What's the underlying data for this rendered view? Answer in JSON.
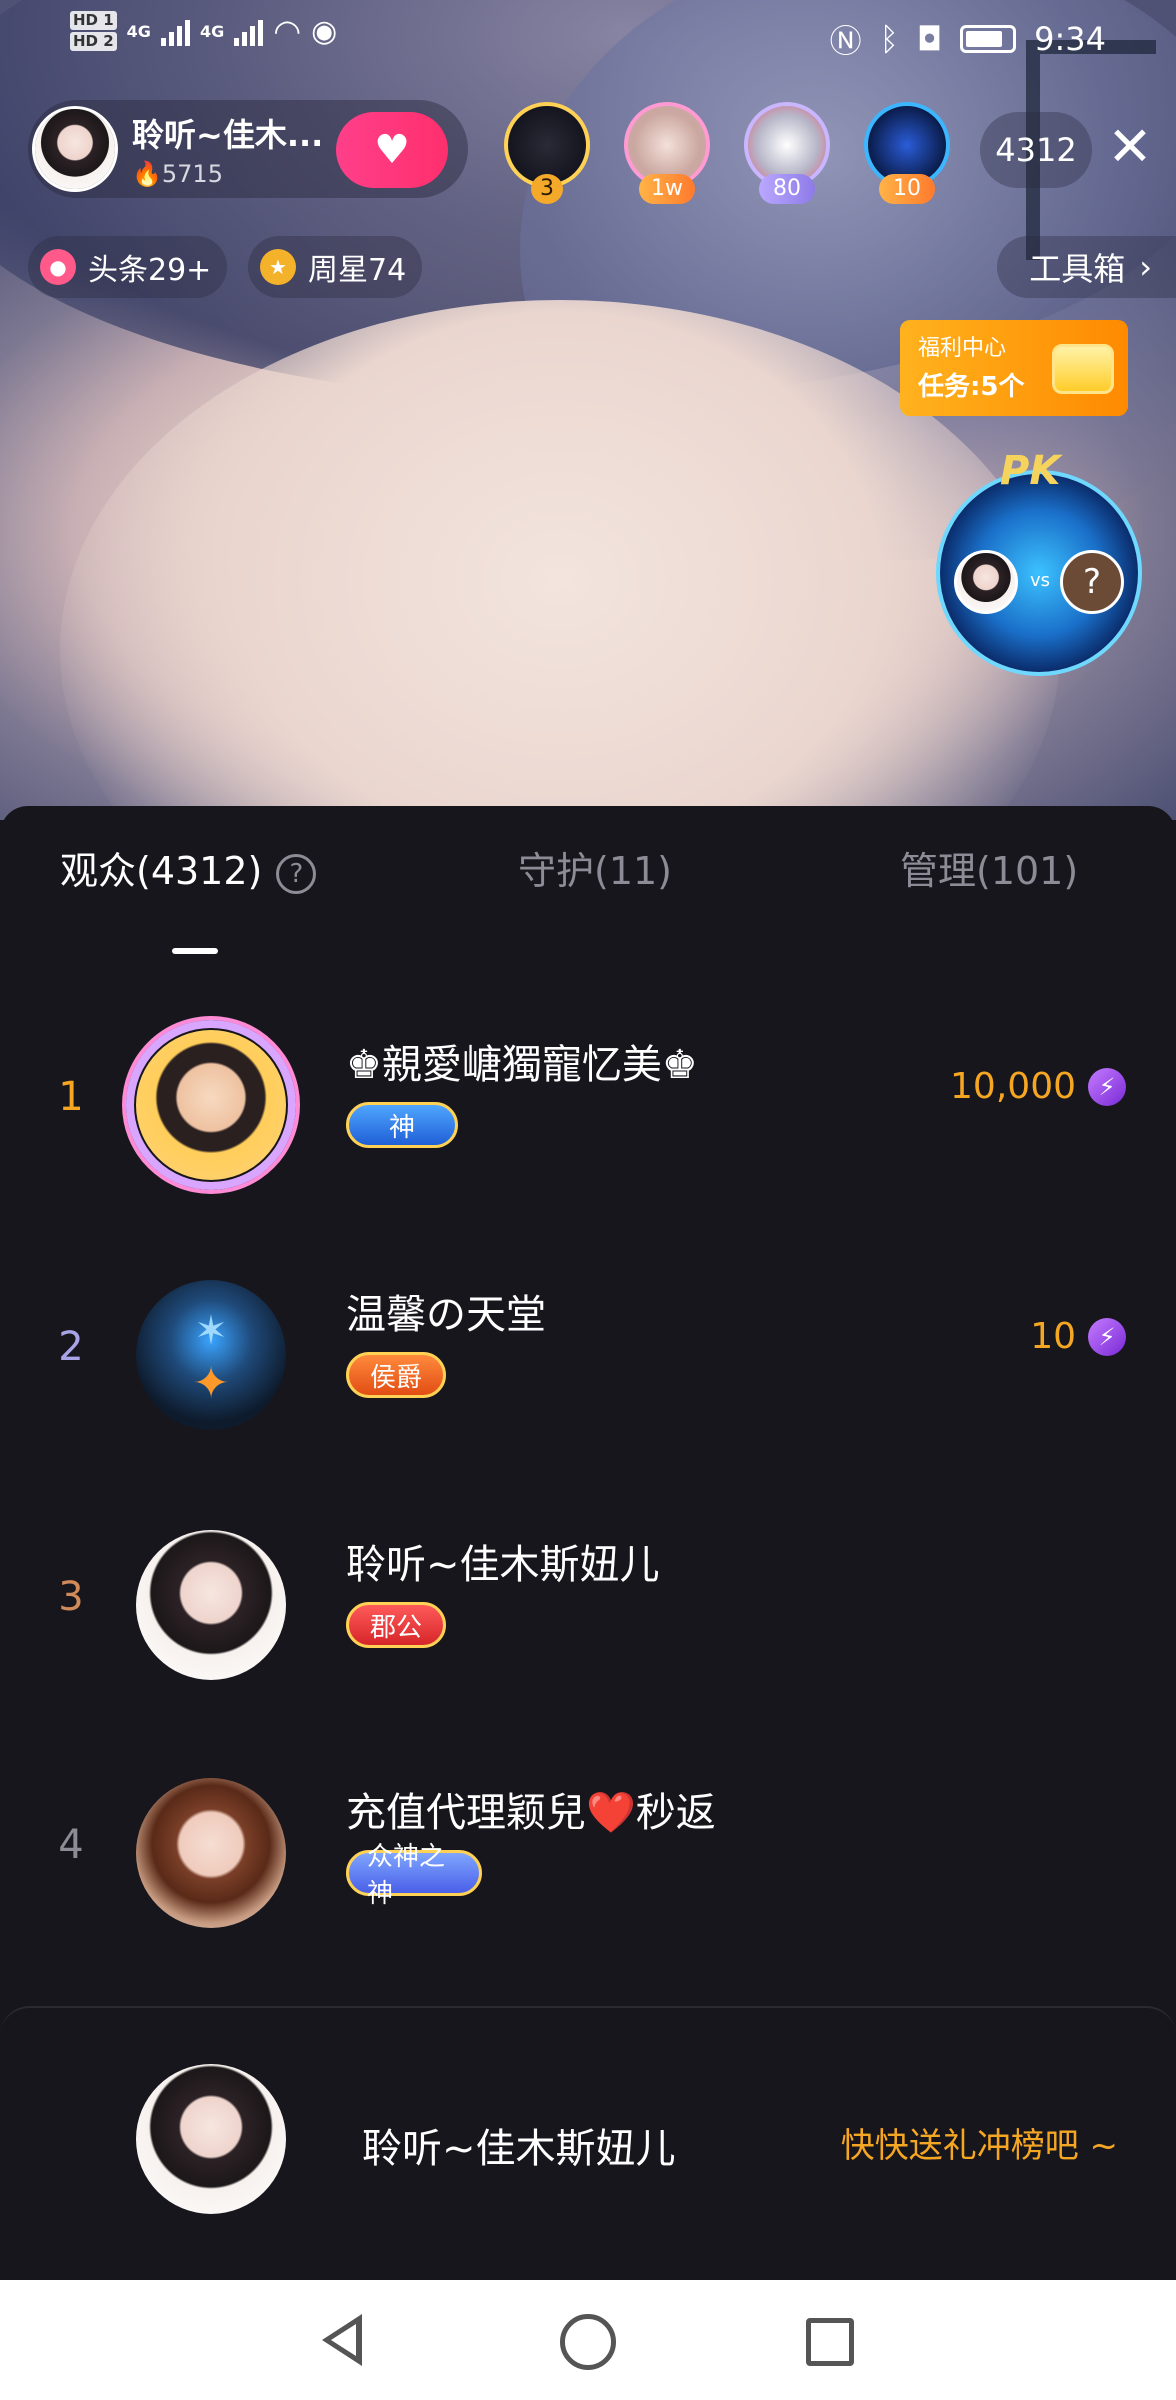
{
  "status_bar": {
    "sim1": "HD 1",
    "sim2": "HD 2",
    "net1": "4G",
    "net2": "4G",
    "time": "9:34"
  },
  "host": {
    "name": "聆听~佳木...",
    "fans": "5715"
  },
  "top_badges": [
    {
      "label": "3"
    },
    {
      "label": "1w"
    },
    {
      "label": "80"
    },
    {
      "label": "10"
    }
  ],
  "viewer_count": "4312",
  "chips": {
    "headline": "头条29+",
    "weekly_star": "周星74",
    "toolbox": "工具箱"
  },
  "welfare": {
    "title": "福利中心",
    "tasks": "任务:5个"
  },
  "pk": {
    "label": "PK",
    "vs": "vs",
    "unknown": "?"
  },
  "tabs": [
    {
      "label": "观众(4312)"
    },
    {
      "label": "守护(11)"
    },
    {
      "label": "管理(101)"
    }
  ],
  "rankings": [
    {
      "rank": "1",
      "name": "♚親愛嵣獨寵忆美♚",
      "badge": "神",
      "score": "10,000",
      "rank_color": "#f5a623"
    },
    {
      "rank": "2",
      "name": "温馨の天堂",
      "badge": "侯爵",
      "score": "10",
      "rank_color": "#a9a3e8"
    },
    {
      "rank": "3",
      "name": "聆听~佳木斯妞儿",
      "badge": "郡公",
      "score": "",
      "rank_color": "#d18a5a"
    },
    {
      "rank": "4",
      "name": "充值代理颖兒❤️秒返",
      "badge": "众神之神",
      "score": "",
      "rank_color": "#8d8b95"
    }
  ],
  "self": {
    "name": "聆听~佳木斯妞儿",
    "cta": "快快送礼冲榜吧 ~"
  },
  "colors": {
    "accent": "#f5a623",
    "sheet_bg": "#17161c",
    "follow_pink": "#ff3f8a"
  }
}
